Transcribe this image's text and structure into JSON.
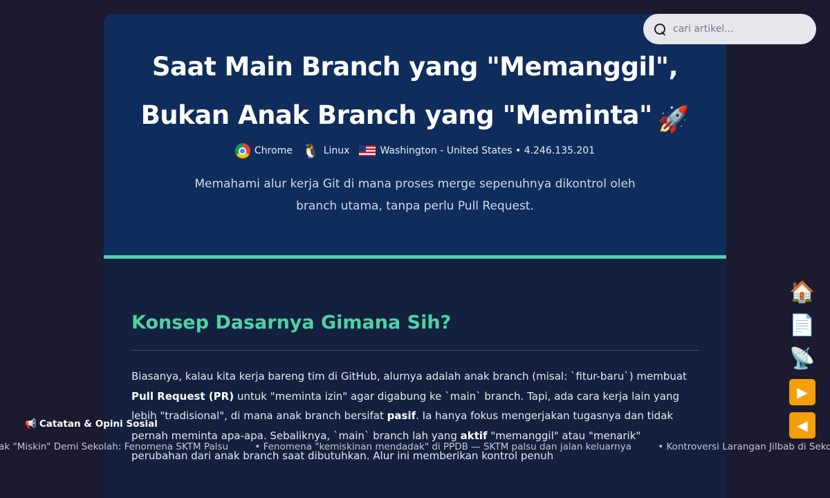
{
  "article": {
    "title_line1": "Saat Main Branch yang \"Memanggil\",",
    "title_line2": "Bukan Anak Branch yang \"Meminta\"",
    "title_emoji": "🚀",
    "meta": {
      "browser": "Chrome",
      "os": "Linux",
      "location": "Washington - United States • 4.246.135.201"
    },
    "subtitle": "Memahami alur kerja Git di mana proses merge sepenuhnya dikontrol oleh branch utama, tanpa perlu Pull Request.",
    "section_heading": "Konsep Dasarnya Gimana Sih?",
    "paragraph": {
      "p1": "Biasanya, kalau kita kerja bareng tim di GitHub, alurnya adalah anak branch (misal: `fitur-baru`) membuat ",
      "b1": "Pull Request (PR)",
      "p2": " untuk \"meminta izin\" agar digabung ke `main` branch. Tapi, ada cara kerja lain yang lebih \"tradisional\", di mana anak branch bersifat ",
      "b2": "pasif",
      "p3": ". Ia hanya fokus mengerjakan tugasnya dan tidak pernah meminta apa-apa. Sebaliknya, `main` branch lah yang ",
      "b3": "aktif",
      "p4": " \"memanggil\" atau \"menarik\" perubahan dari anak branch saat dibutuhkan. Alur ini memberikan kontrol penuh"
    }
  },
  "search": {
    "placeholder": "cari artikel..."
  },
  "side_nav": {
    "home_icon": "🏠",
    "doc_icon": "📄",
    "rss_icon": "📡",
    "next_icon": "▶",
    "prev_icon": "◀"
  },
  "ticker": {
    "label": "Catatan & Opini Sosial",
    "label_icon": "📢",
    "items": [
      "Tidak \"Miskin\" Demi Sekolah: Fenomena SKTM Palsu",
      "• Fenomena \"kemiskinan mendadak\" di PPDB — SKTM palsu dan jalan keluarnya",
      "• Kontroversi Larangan Jilbab di Sekolah"
    ]
  },
  "colors": {
    "page_bg": "#1c1a2e",
    "hero_bg": "#0f2d5c",
    "content_bg": "#13213f",
    "accent": "#4fd1b0",
    "heading_green": "#4fd1a5",
    "nav_orange": "#f59e0b"
  }
}
